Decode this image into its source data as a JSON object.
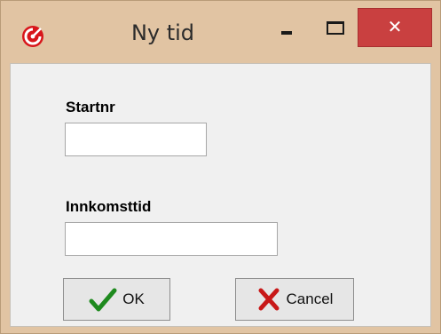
{
  "window": {
    "title": "Ny tid",
    "icon": "app-logo-icon",
    "controls": {
      "minimize_icon": "minimize-icon",
      "maximize_icon": "maximize-icon",
      "close_label": "✕"
    },
    "accent_color": "#c94040",
    "frame_color": "#e1c4a3"
  },
  "form": {
    "startnr": {
      "label": "Startnr",
      "value": ""
    },
    "innkomsttid": {
      "label": "Innkomsttid",
      "value": ""
    }
  },
  "buttons": {
    "ok": {
      "label": "OK",
      "icon": "checkmark-icon"
    },
    "cancel": {
      "label": "Cancel",
      "icon": "red-x-icon"
    }
  }
}
